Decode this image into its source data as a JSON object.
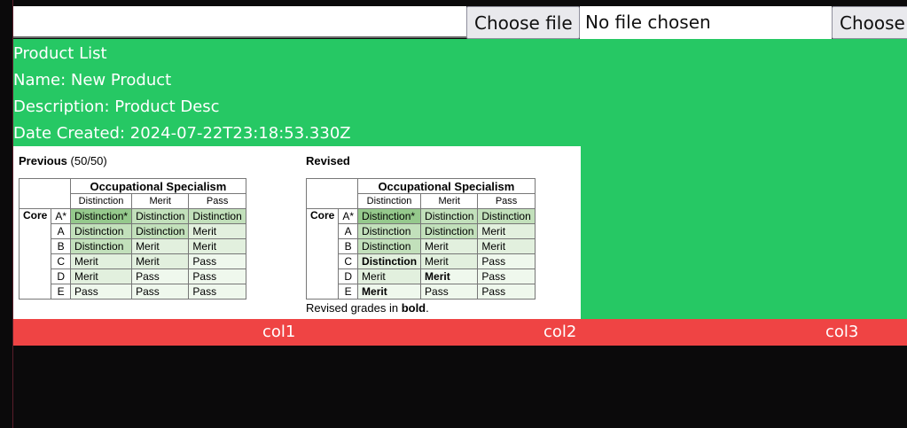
{
  "upload": {
    "file_button_1": "Choose file",
    "file_status_1": "No file chosen",
    "file_button_2": "Choose"
  },
  "product": {
    "heading": "Product List",
    "name": "Name: New Product",
    "description": "Description: Product Desc",
    "date_created": "Date Created: 2024-07-22T23:18:53.330Z"
  },
  "figure": {
    "previous_title": "Previous",
    "previous_count": "(50/50)",
    "revised_title": "Revised",
    "spec_header": "Occupational Specialism",
    "core_label": "Core",
    "sub_headers": [
      "Distinction",
      "Merit",
      "Pass"
    ],
    "previous_rows": [
      {
        "letter": "A*",
        "cells": [
          "Distinction*",
          "Distinction",
          "Distinction"
        ]
      },
      {
        "letter": "A",
        "cells": [
          "Distinction",
          "Distinction",
          "Merit"
        ]
      },
      {
        "letter": "B",
        "cells": [
          "Distinction",
          "Merit",
          "Merit"
        ]
      },
      {
        "letter": "C",
        "cells": [
          "Merit",
          "Merit",
          "Pass"
        ]
      },
      {
        "letter": "D",
        "cells": [
          "Merit",
          "Pass",
          "Pass"
        ]
      },
      {
        "letter": "E",
        "cells": [
          "Pass",
          "Pass",
          "Pass"
        ]
      }
    ],
    "revised_rows": [
      {
        "letter": "A*",
        "cells": [
          "Distinction*",
          "Distinction",
          "Distinction"
        ]
      },
      {
        "letter": "A",
        "cells": [
          "Distinction",
          "Distinction",
          "Merit"
        ]
      },
      {
        "letter": "B",
        "cells": [
          "Distinction",
          "Merit",
          "Merit"
        ]
      },
      {
        "letter": "C",
        "cells": [
          "Distinction",
          "Merit",
          "Pass"
        ]
      },
      {
        "letter": "D",
        "cells": [
          "Merit",
          "Merit",
          "Pass"
        ]
      },
      {
        "letter": "E",
        "cells": [
          "Merit",
          "Pass",
          "Pass"
        ]
      }
    ],
    "note_prefix": "Revised grades in",
    "note_bold": "bold",
    "note_suffix": "."
  },
  "columns": [
    "col1",
    "col2",
    "col3"
  ]
}
